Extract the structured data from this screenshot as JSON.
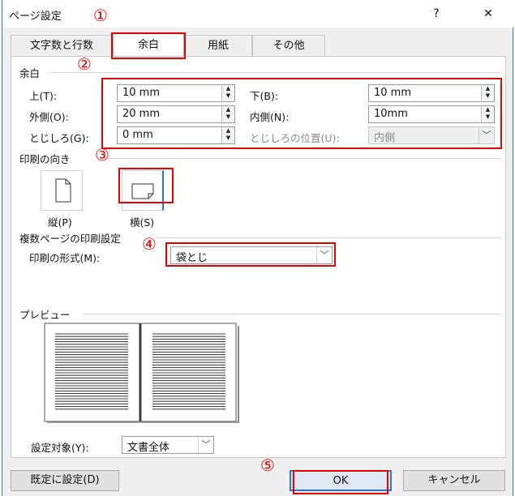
{
  "window": {
    "title": "ページ設定",
    "help": "?",
    "close": "✕"
  },
  "tabs": [
    {
      "label": "文字数と行数"
    },
    {
      "label": "余白"
    },
    {
      "label": "用紙"
    },
    {
      "label": "その他"
    }
  ],
  "margins": {
    "group_title": "余白",
    "top": {
      "label": "上(T):",
      "value": "10 mm"
    },
    "bottom": {
      "label": "下(B):",
      "value": "10 mm"
    },
    "outer": {
      "label": "外側(O):",
      "value": "20 mm"
    },
    "inner": {
      "label": "内側(N):",
      "value": "10mm"
    },
    "gutter": {
      "label": "とじしろ(G):",
      "value": "0 mm"
    },
    "gutter_pos": {
      "label": "とじしろの位置(U):",
      "value": "内側"
    }
  },
  "orientation": {
    "group_title": "印刷の向き",
    "portrait_label": "縦(P)",
    "landscape_label": "横(S)",
    "selected": "landscape"
  },
  "multipage": {
    "group_title": "複数ページの印刷設定",
    "format_label": "印刷の形式(M):",
    "format_value": "袋とじ"
  },
  "preview": {
    "group_title": "プレビュー"
  },
  "apply_to": {
    "label": "設定対象(Y):",
    "value": "文書全体"
  },
  "buttons": {
    "default": "既定に設定(D)",
    "ok": "OK",
    "cancel": "キャンセル"
  },
  "annotations": {
    "n1": "①",
    "n2": "②",
    "n3": "③",
    "n4": "④",
    "n5": "⑤"
  },
  "colors": {
    "highlight": "#e00000",
    "focus": "#2d76c8",
    "dialog_bg": "#f0f0f0"
  }
}
